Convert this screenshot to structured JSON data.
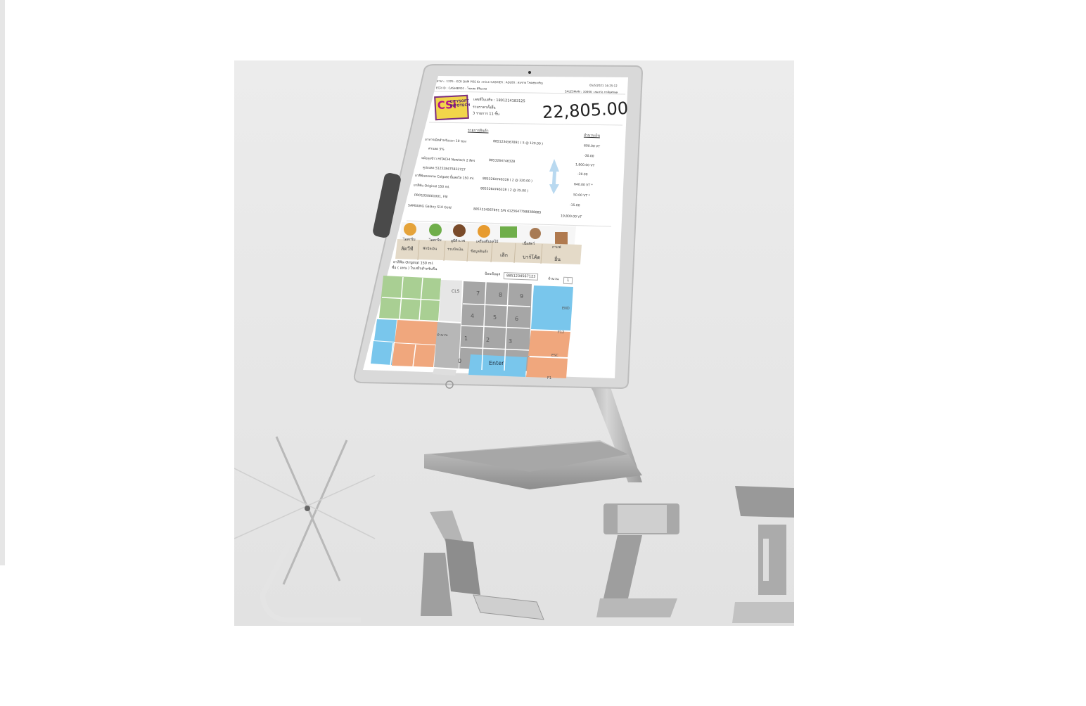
{
  "pos": {
    "header_left_1": "สาขา : 1225 - ECR DAM    POS ID : ECL1    CASHIER : ADL00 : สมชาย โชคสุขเจริญ",
    "header_left_2": "ECR ID : CASHIER01 : โชคสม ศิริมงคล",
    "header_right_1": "05/5/2021    14:25:12",
    "header_right_2": "SALESMAN : 10000 : สมหวัง ภาคิยศรพล",
    "logo_mark": "CSi",
    "logo_name": "CITYSOFT INFOTECH",
    "customer_label": "เลขที่ใบเสร็จ : 1801214183125",
    "member_label": "รวมราคาทั้งสิ้น",
    "item_count": "3 รายการ  11 ชิ้น",
    "total": "22,805.00",
    "list_header": "รายการสินค้า",
    "amount_header": "จำนวนเงิน",
    "lines": [
      {
        "name": "อาหารเม็ดสำหรับแมว 10 ซอง",
        "code": "8851234567891 ( 5 @ 120.00 )",
        "amount": "600.00  VT"
      },
      {
        "name": "ส่วนลด 5%",
        "code": "",
        "amount": "-30.00"
      },
      {
        "name": "หม้อหุงข้าว HITACHI Newtech 2 ลิตร",
        "code": "8853264746328",
        "amount": "1,800.00  VT"
      },
      {
        "name": "คูปองลด 512528475822727",
        "code": "",
        "amount": "-30.00"
      },
      {
        "name": "ยาสีฟันคอลเกต Colgate ยิ้มสดใส 150 ml.",
        "code": "8853264746328 ( 2 @ 320.00 )",
        "amount": "640.00  VT *"
      },
      {
        "name": "ยาสีฟัน Original 150 ml.",
        "code": "8853264746328 ( 2 @ 25.00 )",
        "amount": "50.00  VT *"
      },
      {
        "name": "PRO1050001001, FSI",
        "code": "",
        "amount": "-15.00"
      },
      {
        "name": "SAMSUNG Galaxy S10 Gold",
        "code": "8851234567891  S/N 41256477588388885",
        "amount": "19,800.00  VT"
      }
    ],
    "categories": [
      "ไอศกรีม",
      "ไอศกรีม",
      "ยูบีคิวเวช",
      "เครื่องดื่มผลไม้",
      "เนื้อสัตว์",
      "กาแฟ"
    ],
    "functions": [
      "ลัดวีที",
      "พักบิลเงิน",
      "รวมบิลเงิน",
      "ข้อมูลสินค้า",
      "เลิก",
      "บาร์โค้ด",
      "อื่น"
    ],
    "selected_item": "ยาสีฟัน Original 150 ml.",
    "selected_item_sub": "ชื่อ ( แทน ) ใบเสร็จสำหรับคืน",
    "barcode_label": "ป้อนข้อมูล",
    "barcode_value": "8851234567123",
    "qty_label": "จำนวน",
    "qty_value": "1",
    "keys": [
      "CLS",
      "7",
      "8",
      "9",
      "4",
      "5",
      "6",
      "1",
      "2",
      "3",
      "0",
      "Enter"
    ],
    "qty_key": "จำนวน",
    "fn_keys": [
      "END",
      "F12",
      "ESC",
      "F1"
    ]
  },
  "colors": {
    "green": "#a9cf93",
    "orange": "#f0a77d",
    "blue": "#79c6ec",
    "grey": "#b7b7b7",
    "purple": "#7a2d82",
    "logo_yellow": "#f1d54a"
  }
}
